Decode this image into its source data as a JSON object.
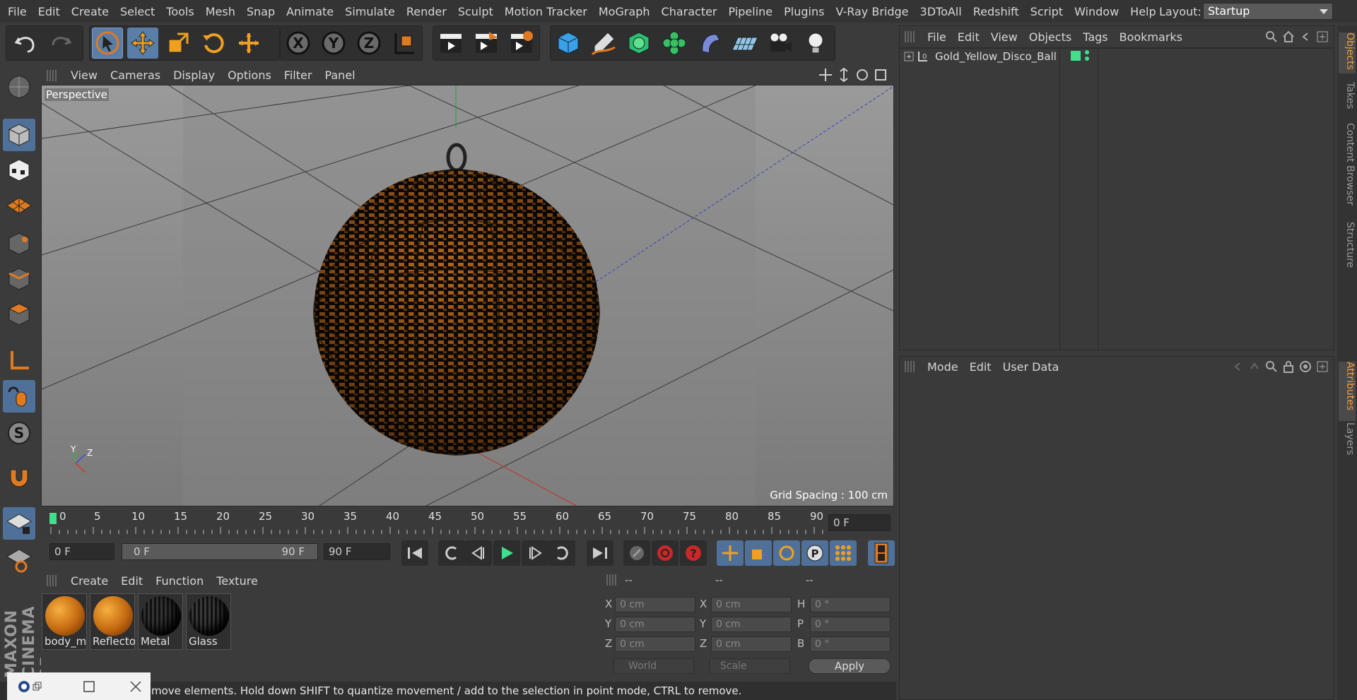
{
  "menu": [
    "File",
    "Edit",
    "Create",
    "Select",
    "Tools",
    "Mesh",
    "Snap",
    "Animate",
    "Simulate",
    "Render",
    "Sculpt",
    "Motion Tracker",
    "MoGraph",
    "Character",
    "Pipeline",
    "Plugins",
    "V-Ray Bridge",
    "3DToAll",
    "Redshift",
    "Script",
    "Window",
    "Help"
  ],
  "layout": {
    "label": "Layout:",
    "value": "Startup"
  },
  "viewport": {
    "menu": [
      "View",
      "Cameras",
      "Display",
      "Options",
      "Filter",
      "Panel"
    ],
    "name": "Perspective",
    "grid_spacing": "Grid Spacing : 100 cm"
  },
  "timeline": {
    "ticks": [
      "0",
      "5",
      "10",
      "15",
      "20",
      "25",
      "30",
      "35",
      "40",
      "45",
      "50",
      "55",
      "60",
      "65",
      "70",
      "75",
      "80",
      "85",
      "90"
    ],
    "current": "0 F",
    "start": "0 F",
    "range_start": "0 F",
    "range_end": "90 F",
    "end": "90 F"
  },
  "materials": {
    "menu": [
      "Create",
      "Edit",
      "Function",
      "Texture"
    ],
    "items": [
      {
        "name": "body_m",
        "color": "#d07a1a"
      },
      {
        "name": "Reflecto",
        "color": "#d07a1a"
      },
      {
        "name": "Metal",
        "color": "#2a2a2a"
      },
      {
        "name": "Glass",
        "color": "#2a2a2a"
      }
    ]
  },
  "coords": {
    "headers": [
      "--",
      "--",
      "--"
    ],
    "rows": [
      {
        "a": "X",
        "av": "0 cm",
        "b": "X",
        "bv": "0 cm",
        "c": "H",
        "cv": "0 °"
      },
      {
        "a": "Y",
        "av": "0 cm",
        "b": "Y",
        "bv": "0 cm",
        "c": "P",
        "cv": "0 °"
      },
      {
        "a": "Z",
        "av": "0 cm",
        "b": "Z",
        "bv": "0 cm",
        "c": "B",
        "cv": "0 °"
      }
    ],
    "world": "World",
    "scale": "Scale",
    "apply": "Apply"
  },
  "objects": {
    "menu": [
      "File",
      "Edit",
      "View",
      "Objects",
      "Tags",
      "Bookmarks"
    ],
    "item": "Gold_Yellow_Disco_Ball"
  },
  "attributes": {
    "menu": [
      "Mode",
      "Edit",
      "User Data"
    ]
  },
  "side_tabs": [
    "Objects",
    "Takes",
    "Content Browser",
    "Structure"
  ],
  "side_tabs2": [
    "Attributes",
    "Layers"
  ],
  "status": "move elements. Hold down SHIFT to quantize movement / add to the selection in point mode, CTRL to remove.",
  "brand": "MAXON CINEMA 4D"
}
